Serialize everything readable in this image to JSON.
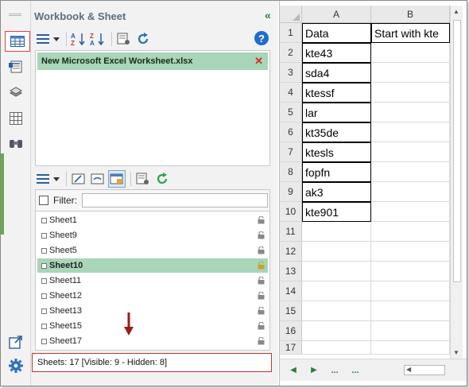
{
  "pane": {
    "title": "Workbook & Sheet",
    "collapse_icon": "«",
    "help_label": "?",
    "workbook": "New Microsoft Excel Worksheet.xlsx",
    "filter_label": "Filter:",
    "filter_value": "",
    "sheets": [
      {
        "name": "Sheet1",
        "selected": false
      },
      {
        "name": "Sheet9",
        "selected": false
      },
      {
        "name": "Sheet5",
        "selected": false
      },
      {
        "name": "Sheet10",
        "selected": true
      },
      {
        "name": "Sheet11",
        "selected": false
      },
      {
        "name": "Sheet12",
        "selected": false
      },
      {
        "name": "Sheet13",
        "selected": false
      },
      {
        "name": "Sheet15",
        "selected": false
      },
      {
        "name": "Sheet17",
        "selected": false
      }
    ],
    "status": "Sheets: 17  [Visible: 9 - Hidden: 8]"
  },
  "sheet": {
    "columns": [
      "A",
      "B"
    ],
    "rows": [
      {
        "num": "1",
        "a": "Data",
        "b": "Start with kte"
      },
      {
        "num": "2",
        "a": "kte43",
        "b": ""
      },
      {
        "num": "3",
        "a": "sda4",
        "b": ""
      },
      {
        "num": "4",
        "a": "ktessf",
        "b": ""
      },
      {
        "num": "5",
        "a": "lar",
        "b": ""
      },
      {
        "num": "6",
        "a": "kt35de",
        "b": ""
      },
      {
        "num": "7",
        "a": "ktesls",
        "b": ""
      },
      {
        "num": "8",
        "a": "fopfn",
        "b": ""
      },
      {
        "num": "9",
        "a": "ak3",
        "b": ""
      },
      {
        "num": "10",
        "a": "kte901",
        "b": ""
      },
      {
        "num": "11",
        "a": "",
        "b": ""
      },
      {
        "num": "12",
        "a": "",
        "b": ""
      },
      {
        "num": "13",
        "a": "",
        "b": ""
      },
      {
        "num": "14",
        "a": "",
        "b": ""
      },
      {
        "num": "15",
        "a": "",
        "b": ""
      },
      {
        "num": "16",
        "a": "",
        "b": ""
      },
      {
        "num": "17",
        "a": "",
        "b": ""
      }
    ],
    "tab_nav": {
      "prev": "◀",
      "next": "▶",
      "more": "..."
    }
  },
  "colors": {
    "selected_green": "#a9d5b8",
    "status_border": "#c0392b",
    "accent_green": "#2f7d3f",
    "help_blue": "#1e6fc8"
  },
  "icons": [
    "workbook-sheet-icon",
    "header-footer-icon",
    "layers-icon",
    "table-icon",
    "find-replace-icon",
    "export-icon",
    "settings-gear-icon"
  ]
}
